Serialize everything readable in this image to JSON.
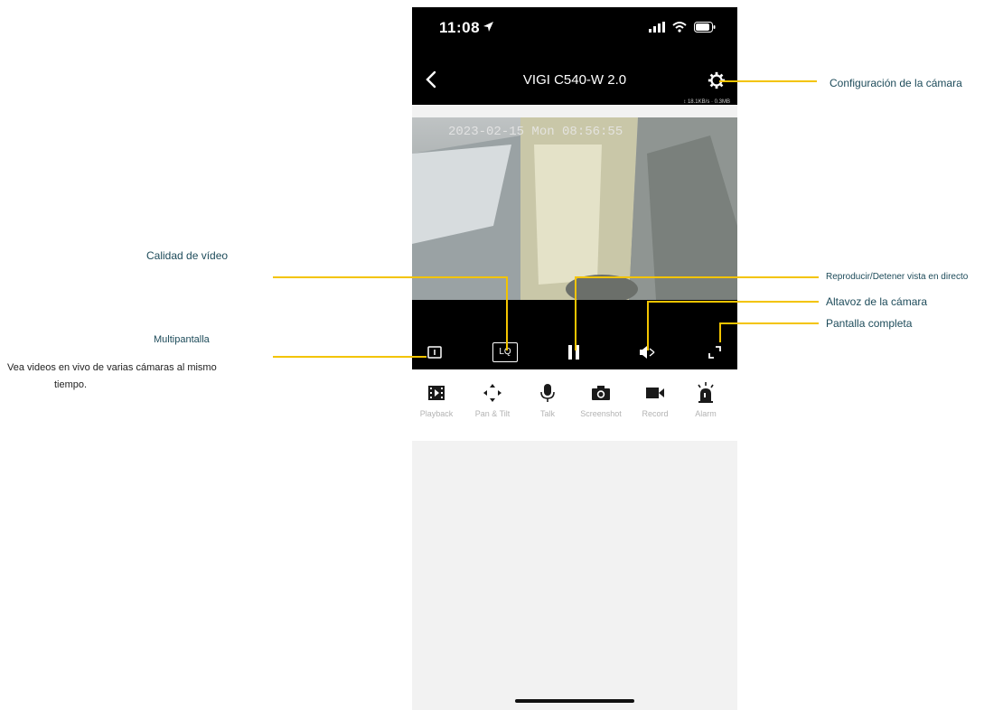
{
  "status_bar": {
    "time": "11:08"
  },
  "nav": {
    "title": "VIGI C540-W 2.0",
    "net_stats": "↕ 18.1KB/s · 0.3MB"
  },
  "video": {
    "osd_text": "2023-02-15 Mon 08:56:55"
  },
  "controls": {
    "quality_label": "LQ"
  },
  "toolbar": {
    "items": [
      {
        "label": "Playback",
        "icon": "film-icon"
      },
      {
        "label": "Pan & Tilt",
        "icon": "pan-tilt-icon"
      },
      {
        "label": "Talk",
        "icon": "microphone-icon"
      },
      {
        "label": "Screenshot",
        "icon": "camera-icon"
      },
      {
        "label": "Record",
        "icon": "video-camera-icon"
      },
      {
        "label": "Alarm",
        "icon": "alarm-icon"
      }
    ]
  },
  "annotations": {
    "camera_settings": "Configuración de la cámara",
    "video_quality": "Calidad de vídeo",
    "play_stop": "Reproducir/Detener vista en directo",
    "camera_speaker": "Altavoz de la cámara",
    "fullscreen": "Pantalla completa",
    "multiscreen": "Multipantalla",
    "multiscreen_desc_1": "Vea videos en vivo de varias cámaras al mismo",
    "multiscreen_desc_2": "tiempo."
  },
  "colors": {
    "annotation_line": "#f3c400",
    "annotation_text": "#1d4b5a"
  }
}
